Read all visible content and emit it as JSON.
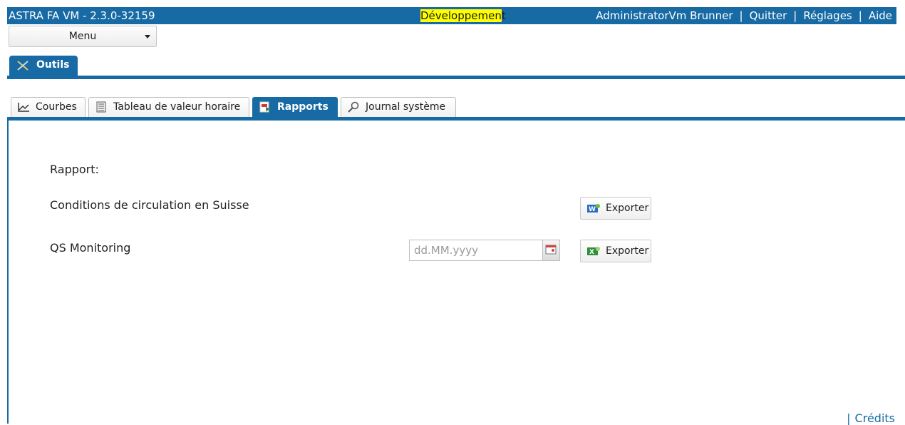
{
  "header": {
    "app_title": "ASTRA FA VM - 2.3.0-32159",
    "environment_highlight": "Développemen",
    "environment_rest": "t",
    "user": "AdministratorVm Brunner",
    "quit": "Quitter",
    "settings": "Réglages",
    "help": "Aide",
    "separator": "|"
  },
  "menu": {
    "label": "Menu"
  },
  "main_tab": {
    "label": "Outils"
  },
  "sub_tabs": [
    {
      "label": "Courbes",
      "icon": "line-chart-icon"
    },
    {
      "label": "Tableau de valeur horaire",
      "icon": "table-icon"
    },
    {
      "label": "Rapports",
      "icon": "report-icon",
      "active": true
    },
    {
      "label": "Journal système",
      "icon": "magnifier-icon"
    }
  ],
  "content": {
    "section_label": "Rapport:",
    "reports": [
      {
        "name": "Conditions de circulation en Suisse",
        "export_label": "Exporter",
        "icon": "word-icon"
      },
      {
        "name": "QS Monitoring",
        "export_label": "Exporter",
        "icon": "excel-icon",
        "date_placeholder": "dd.MM.yyyy"
      }
    ]
  },
  "footer": {
    "separator": "|",
    "credits": "Crédits"
  },
  "colors": {
    "accent": "#176aa4",
    "highlight": "#ffff00"
  }
}
